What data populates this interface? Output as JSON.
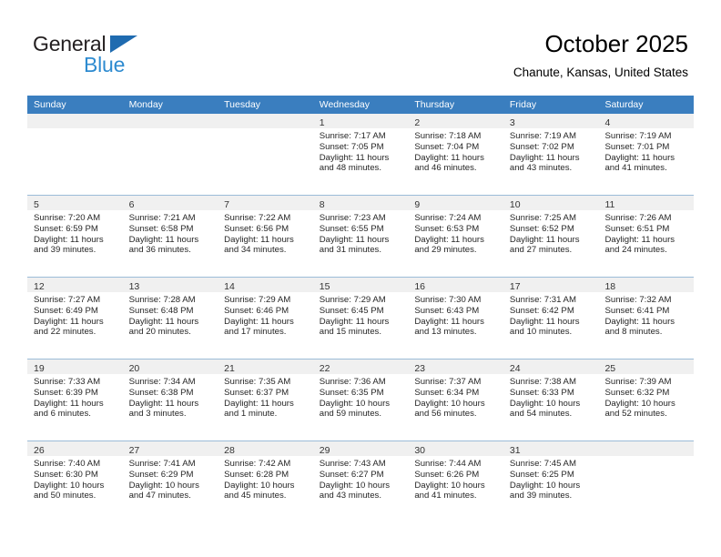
{
  "brand": {
    "name_part1": "General",
    "name_part2": "Blue",
    "accent_color": "#2e8bd0",
    "triangle_color": "#1f6bb0"
  },
  "header": {
    "title": "October 2025",
    "location": "Chanute, Kansas, United States"
  },
  "theme": {
    "header_bg": "#3a7ebf",
    "header_text": "#ffffff",
    "date_band_bg": "#f0f0f0",
    "row_divider": "#9bbcd8",
    "cell_bg": "#ffffff",
    "body_text": "#262626"
  },
  "weekdays": [
    "Sunday",
    "Monday",
    "Tuesday",
    "Wednesday",
    "Thursday",
    "Friday",
    "Saturday"
  ],
  "labels": {
    "sunrise_prefix": "Sunrise:",
    "sunset_prefix": "Sunset:",
    "daylight_prefix": "Daylight:"
  },
  "weeks": [
    [
      {
        "date": "",
        "empty": true,
        "sunrise": "",
        "sunset": "",
        "daylight_line1": "",
        "daylight_line2": ""
      },
      {
        "date": "",
        "empty": true,
        "sunrise": "",
        "sunset": "",
        "daylight_line1": "",
        "daylight_line2": ""
      },
      {
        "date": "",
        "empty": true,
        "sunrise": "",
        "sunset": "",
        "daylight_line1": "",
        "daylight_line2": ""
      },
      {
        "date": "1",
        "empty": false,
        "sunrise": "Sunrise: 7:17 AM",
        "sunset": "Sunset: 7:05 PM",
        "daylight_line1": "Daylight: 11 hours",
        "daylight_line2": "and 48 minutes."
      },
      {
        "date": "2",
        "empty": false,
        "sunrise": "Sunrise: 7:18 AM",
        "sunset": "Sunset: 7:04 PM",
        "daylight_line1": "Daylight: 11 hours",
        "daylight_line2": "and 46 minutes."
      },
      {
        "date": "3",
        "empty": false,
        "sunrise": "Sunrise: 7:19 AM",
        "sunset": "Sunset: 7:02 PM",
        "daylight_line1": "Daylight: 11 hours",
        "daylight_line2": "and 43 minutes."
      },
      {
        "date": "4",
        "empty": false,
        "sunrise": "Sunrise: 7:19 AM",
        "sunset": "Sunset: 7:01 PM",
        "daylight_line1": "Daylight: 11 hours",
        "daylight_line2": "and 41 minutes."
      }
    ],
    [
      {
        "date": "5",
        "empty": false,
        "sunrise": "Sunrise: 7:20 AM",
        "sunset": "Sunset: 6:59 PM",
        "daylight_line1": "Daylight: 11 hours",
        "daylight_line2": "and 39 minutes."
      },
      {
        "date": "6",
        "empty": false,
        "sunrise": "Sunrise: 7:21 AM",
        "sunset": "Sunset: 6:58 PM",
        "daylight_line1": "Daylight: 11 hours",
        "daylight_line2": "and 36 minutes."
      },
      {
        "date": "7",
        "empty": false,
        "sunrise": "Sunrise: 7:22 AM",
        "sunset": "Sunset: 6:56 PM",
        "daylight_line1": "Daylight: 11 hours",
        "daylight_line2": "and 34 minutes."
      },
      {
        "date": "8",
        "empty": false,
        "sunrise": "Sunrise: 7:23 AM",
        "sunset": "Sunset: 6:55 PM",
        "daylight_line1": "Daylight: 11 hours",
        "daylight_line2": "and 31 minutes."
      },
      {
        "date": "9",
        "empty": false,
        "sunrise": "Sunrise: 7:24 AM",
        "sunset": "Sunset: 6:53 PM",
        "daylight_line1": "Daylight: 11 hours",
        "daylight_line2": "and 29 minutes."
      },
      {
        "date": "10",
        "empty": false,
        "sunrise": "Sunrise: 7:25 AM",
        "sunset": "Sunset: 6:52 PM",
        "daylight_line1": "Daylight: 11 hours",
        "daylight_line2": "and 27 minutes."
      },
      {
        "date": "11",
        "empty": false,
        "sunrise": "Sunrise: 7:26 AM",
        "sunset": "Sunset: 6:51 PM",
        "daylight_line1": "Daylight: 11 hours",
        "daylight_line2": "and 24 minutes."
      }
    ],
    [
      {
        "date": "12",
        "empty": false,
        "sunrise": "Sunrise: 7:27 AM",
        "sunset": "Sunset: 6:49 PM",
        "daylight_line1": "Daylight: 11 hours",
        "daylight_line2": "and 22 minutes."
      },
      {
        "date": "13",
        "empty": false,
        "sunrise": "Sunrise: 7:28 AM",
        "sunset": "Sunset: 6:48 PM",
        "daylight_line1": "Daylight: 11 hours",
        "daylight_line2": "and 20 minutes."
      },
      {
        "date": "14",
        "empty": false,
        "sunrise": "Sunrise: 7:29 AM",
        "sunset": "Sunset: 6:46 PM",
        "daylight_line1": "Daylight: 11 hours",
        "daylight_line2": "and 17 minutes."
      },
      {
        "date": "15",
        "empty": false,
        "sunrise": "Sunrise: 7:29 AM",
        "sunset": "Sunset: 6:45 PM",
        "daylight_line1": "Daylight: 11 hours",
        "daylight_line2": "and 15 minutes."
      },
      {
        "date": "16",
        "empty": false,
        "sunrise": "Sunrise: 7:30 AM",
        "sunset": "Sunset: 6:43 PM",
        "daylight_line1": "Daylight: 11 hours",
        "daylight_line2": "and 13 minutes."
      },
      {
        "date": "17",
        "empty": false,
        "sunrise": "Sunrise: 7:31 AM",
        "sunset": "Sunset: 6:42 PM",
        "daylight_line1": "Daylight: 11 hours",
        "daylight_line2": "and 10 minutes."
      },
      {
        "date": "18",
        "empty": false,
        "sunrise": "Sunrise: 7:32 AM",
        "sunset": "Sunset: 6:41 PM",
        "daylight_line1": "Daylight: 11 hours",
        "daylight_line2": "and 8 minutes."
      }
    ],
    [
      {
        "date": "19",
        "empty": false,
        "sunrise": "Sunrise: 7:33 AM",
        "sunset": "Sunset: 6:39 PM",
        "daylight_line1": "Daylight: 11 hours",
        "daylight_line2": "and 6 minutes."
      },
      {
        "date": "20",
        "empty": false,
        "sunrise": "Sunrise: 7:34 AM",
        "sunset": "Sunset: 6:38 PM",
        "daylight_line1": "Daylight: 11 hours",
        "daylight_line2": "and 3 minutes."
      },
      {
        "date": "21",
        "empty": false,
        "sunrise": "Sunrise: 7:35 AM",
        "sunset": "Sunset: 6:37 PM",
        "daylight_line1": "Daylight: 11 hours",
        "daylight_line2": "and 1 minute."
      },
      {
        "date": "22",
        "empty": false,
        "sunrise": "Sunrise: 7:36 AM",
        "sunset": "Sunset: 6:35 PM",
        "daylight_line1": "Daylight: 10 hours",
        "daylight_line2": "and 59 minutes."
      },
      {
        "date": "23",
        "empty": false,
        "sunrise": "Sunrise: 7:37 AM",
        "sunset": "Sunset: 6:34 PM",
        "daylight_line1": "Daylight: 10 hours",
        "daylight_line2": "and 56 minutes."
      },
      {
        "date": "24",
        "empty": false,
        "sunrise": "Sunrise: 7:38 AM",
        "sunset": "Sunset: 6:33 PM",
        "daylight_line1": "Daylight: 10 hours",
        "daylight_line2": "and 54 minutes."
      },
      {
        "date": "25",
        "empty": false,
        "sunrise": "Sunrise: 7:39 AM",
        "sunset": "Sunset: 6:32 PM",
        "daylight_line1": "Daylight: 10 hours",
        "daylight_line2": "and 52 minutes."
      }
    ],
    [
      {
        "date": "26",
        "empty": false,
        "sunrise": "Sunrise: 7:40 AM",
        "sunset": "Sunset: 6:30 PM",
        "daylight_line1": "Daylight: 10 hours",
        "daylight_line2": "and 50 minutes."
      },
      {
        "date": "27",
        "empty": false,
        "sunrise": "Sunrise: 7:41 AM",
        "sunset": "Sunset: 6:29 PM",
        "daylight_line1": "Daylight: 10 hours",
        "daylight_line2": "and 47 minutes."
      },
      {
        "date": "28",
        "empty": false,
        "sunrise": "Sunrise: 7:42 AM",
        "sunset": "Sunset: 6:28 PM",
        "daylight_line1": "Daylight: 10 hours",
        "daylight_line2": "and 45 minutes."
      },
      {
        "date": "29",
        "empty": false,
        "sunrise": "Sunrise: 7:43 AM",
        "sunset": "Sunset: 6:27 PM",
        "daylight_line1": "Daylight: 10 hours",
        "daylight_line2": "and 43 minutes."
      },
      {
        "date": "30",
        "empty": false,
        "sunrise": "Sunrise: 7:44 AM",
        "sunset": "Sunset: 6:26 PM",
        "daylight_line1": "Daylight: 10 hours",
        "daylight_line2": "and 41 minutes."
      },
      {
        "date": "31",
        "empty": false,
        "sunrise": "Sunrise: 7:45 AM",
        "sunset": "Sunset: 6:25 PM",
        "daylight_line1": "Daylight: 10 hours",
        "daylight_line2": "and 39 minutes."
      },
      {
        "date": "",
        "empty": true,
        "sunrise": "",
        "sunset": "",
        "daylight_line1": "",
        "daylight_line2": ""
      }
    ]
  ]
}
